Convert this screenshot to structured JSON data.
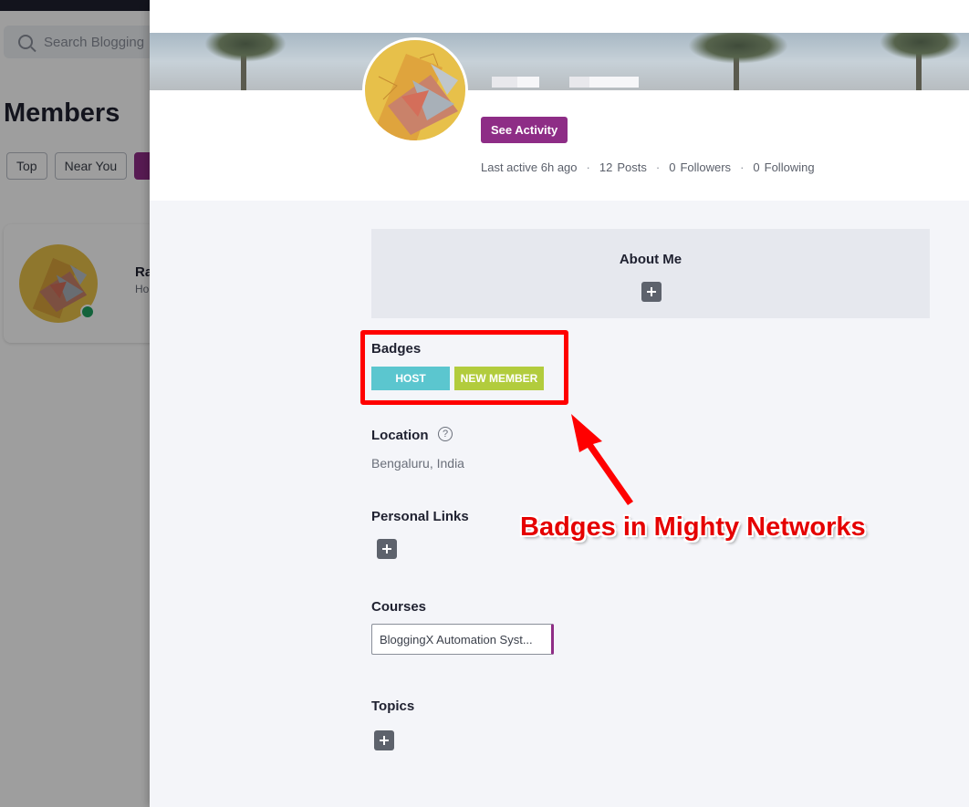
{
  "background_page": {
    "search_placeholder": "Search Blogging",
    "title": "Members",
    "filter_chips": [
      "Top",
      "Near You"
    ],
    "member_card": {
      "name": "Ra",
      "subtitle": "Ho"
    }
  },
  "profile": {
    "see_activity_label": "See Activity",
    "stats": {
      "last_active": "Last active 6h ago",
      "posts_count": "12",
      "posts_label": "Posts",
      "followers_count": "0",
      "followers_label": "Followers",
      "following_count": "0",
      "following_label": "Following",
      "separator": "·"
    }
  },
  "sections": {
    "about_me": "About Me",
    "badges": "Badges",
    "location": "Location",
    "location_help": "?",
    "location_value": "Bengaluru, India",
    "personal_links": "Personal Links",
    "courses": "Courses",
    "topics": "Topics"
  },
  "badges": [
    {
      "label": "HOST",
      "color": "#5bc6cf"
    },
    {
      "label": "NEW MEMBER",
      "color": "#b2cc3d"
    }
  ],
  "courses": [
    "BloggingX Automation Syst..."
  ],
  "annotation": {
    "label": "Badges in Mighty Networks",
    "color": "#ff0000"
  },
  "colors": {
    "accent": "#8e2d86",
    "online": "#1fa160"
  }
}
